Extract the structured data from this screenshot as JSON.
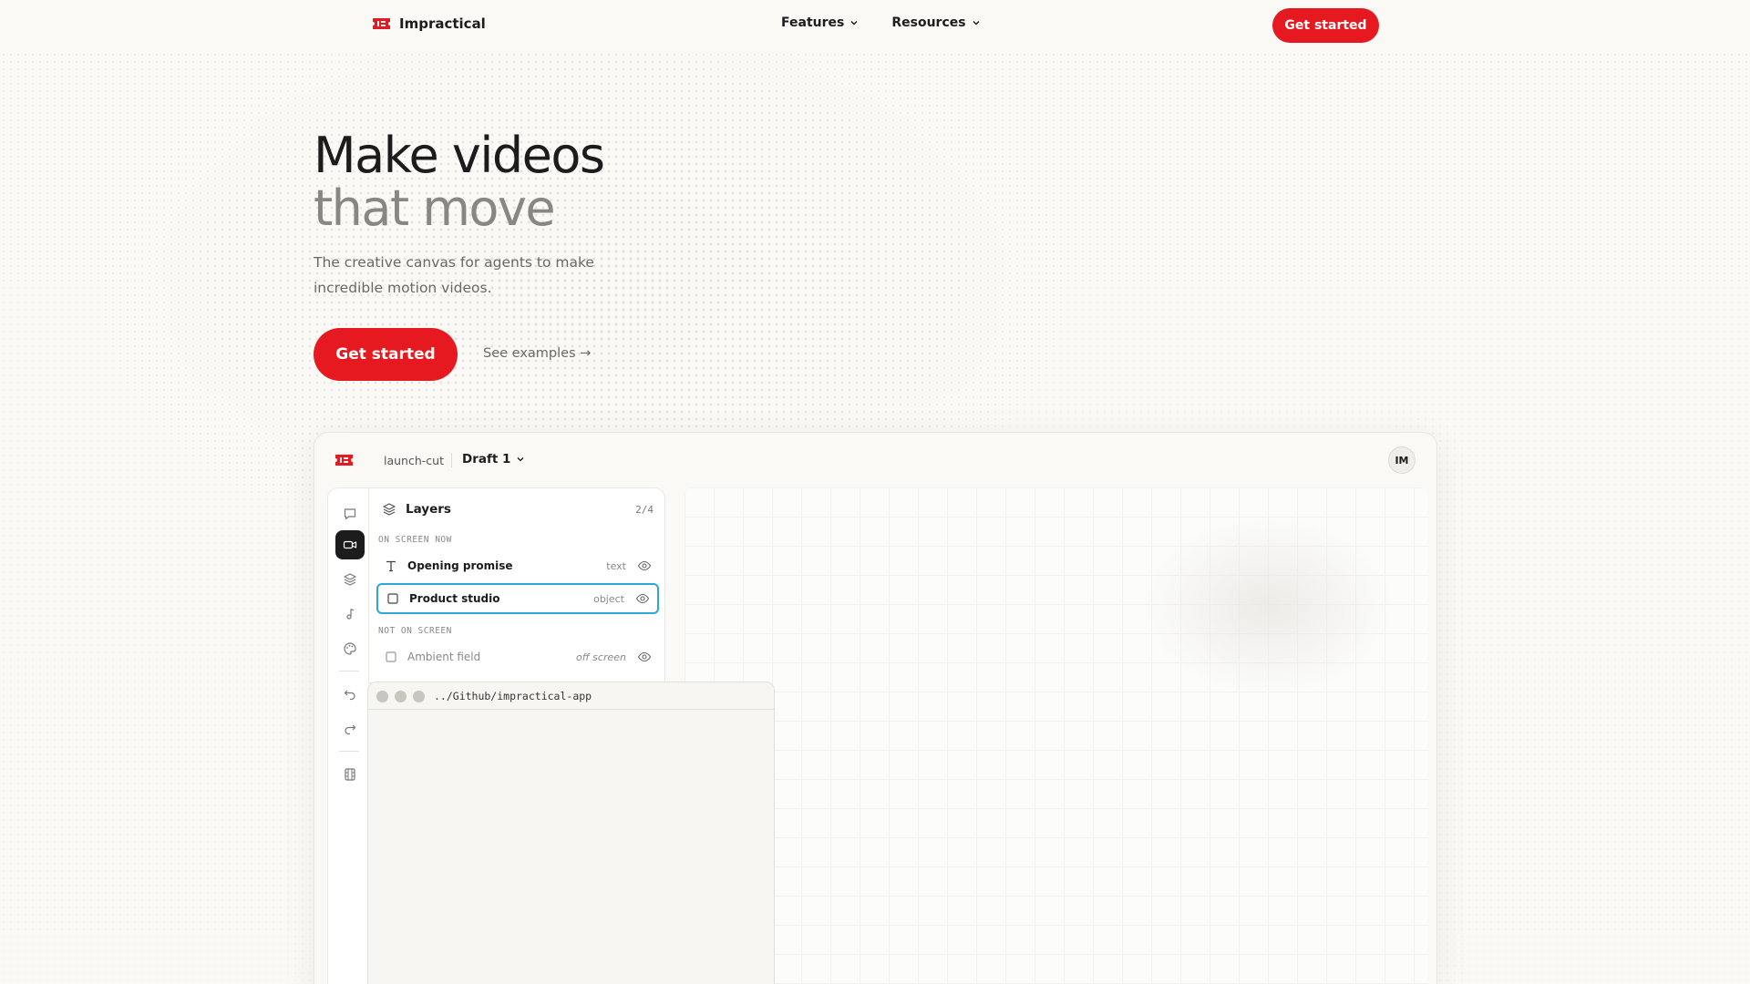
{
  "nav": {
    "brand": "Impractical",
    "menu": [
      {
        "label": "Features"
      },
      {
        "label": "Resources"
      }
    ],
    "cta": "Get started"
  },
  "hero": {
    "title_line1": "Make videos",
    "title_line2": "that move",
    "subtitle": "The creative canvas for agents to make incredible motion videos.",
    "cta": "Get started",
    "link": "See examples →"
  },
  "app": {
    "project": "launch-cut",
    "draft": "Draft 1",
    "avatar": "IM",
    "layers": {
      "title": "Layers",
      "count": "2/4",
      "on_screen_label": "ON SCREEN NOW",
      "not_on_screen_label": "NOT ON SCREEN",
      "items": [
        {
          "name": "Opening promise",
          "type": "text",
          "icon": "text-icon"
        },
        {
          "name": "Product studio",
          "type": "object",
          "icon": "square-icon",
          "selected": true
        },
        {
          "name": "Ambient field",
          "type": "off screen",
          "icon": "square-icon"
        }
      ]
    },
    "terminal": {
      "path": "../Github/impractical-app"
    }
  },
  "colors": {
    "accent": "#e5191f",
    "selection": "#2aa8d6",
    "background": "#faf9f6"
  }
}
